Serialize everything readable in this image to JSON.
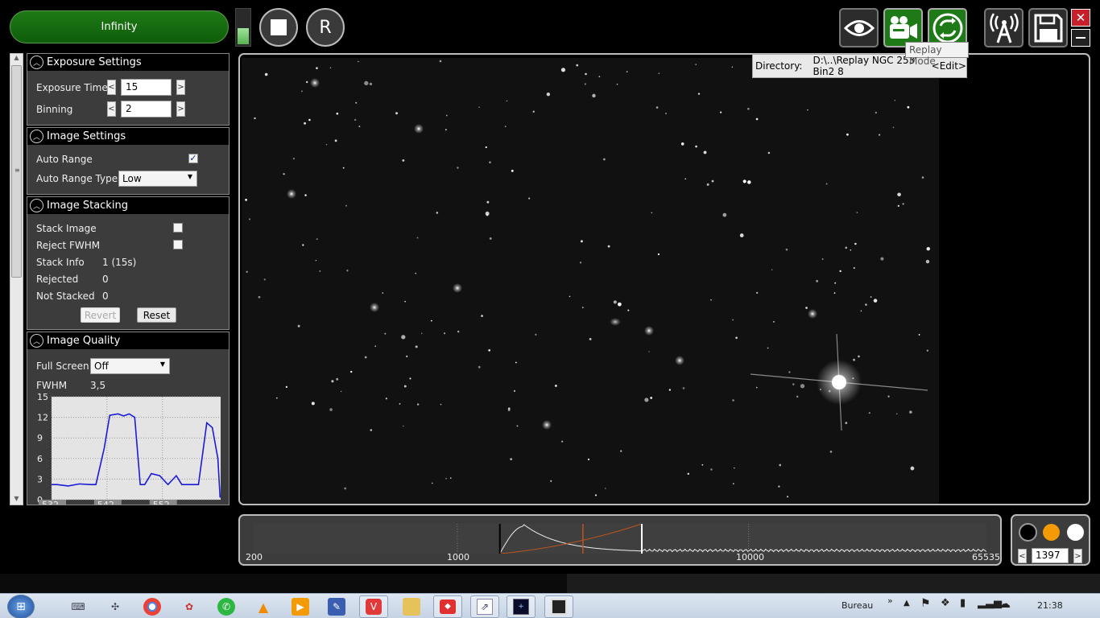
{
  "toolbar": {
    "infinity_label": "Infinity",
    "stop_icon": "stop-icon",
    "replay_label": "R",
    "level_meter_fill": 0.45
  },
  "tools": {
    "view_icon": "eye-icon",
    "camera_icon": "video-camera-icon",
    "replay_mode_icon": "replay-mode-icon",
    "broadcast_icon": "antenna-icon",
    "save_icon": "floppy-disk-icon",
    "tooltip": "Replay Mode"
  },
  "directory": {
    "label": "Directory:",
    "value": "D:\\..\\Replay NGC 253 Bin2 8",
    "edit": "<Edit>"
  },
  "exposure_settings": {
    "title": "Exposure Settings",
    "exposure_time_label": "Exposure Time",
    "exposure_time_value": "15",
    "binning_label": "Binning",
    "binning_value": "2"
  },
  "image_settings": {
    "title": "Image Settings",
    "auto_range_label": "Auto Range",
    "auto_range_checked": true,
    "auto_range_type_label": "Auto Range Type",
    "auto_range_type_value": "Low"
  },
  "image_stacking": {
    "title": "Image Stacking",
    "stack_image_label": "Stack Image",
    "reject_fwhm_label": "Reject FWHM",
    "stack_info_label": "Stack Info",
    "stack_info_value": "1 (15s)",
    "rejected_label": "Rejected",
    "rejected_value": "0",
    "not_stacked_label": "Not Stacked",
    "not_stacked_value": "0",
    "revert_label": "Revert",
    "reset_label": "Reset"
  },
  "image_quality": {
    "title": "Image Quality",
    "full_screen_label": "Full Screen",
    "full_screen_value": "Off",
    "fwhm_label": "FWHM",
    "fwhm_value": "3,5"
  },
  "chart_data": {
    "type": "line",
    "ylim": [
      0,
      15
    ],
    "y_ticks": [
      "15",
      "12",
      "9",
      "6",
      "3",
      "0"
    ],
    "x_ticks": [
      "532",
      "542",
      "552"
    ],
    "series": [
      {
        "x": [
          532,
          533,
          535,
          537,
          539,
          540,
          541.5,
          542.5,
          544,
          545,
          546,
          547,
          548,
          548.8,
          550,
          551.5,
          553,
          554.5,
          555.5,
          556.5,
          557.5,
          558.5,
          560,
          561,
          562,
          562.4
        ],
        "y": [
          2.2,
          2.2,
          2.0,
          2.3,
          2.2,
          2.2,
          7.5,
          12.3,
          12.5,
          12.2,
          12.5,
          12.0,
          2.2,
          2.2,
          3.8,
          3.5,
          2.2,
          3.5,
          2.2,
          2.2,
          2.2,
          2.2,
          11.2,
          10.5,
          6.0,
          0.3
        ]
      }
    ]
  },
  "histogram": {
    "ticks": [
      "200",
      "1000",
      "10000",
      "65535"
    ],
    "black_point": 1400,
    "white_point": 4300
  },
  "color_swatches": [
    "#000000",
    "#f39a06",
    "#ffffff"
  ],
  "display_value": "1397",
  "taskbar": {
    "desktop_label": "Bureau",
    "clock": "21:38"
  }
}
